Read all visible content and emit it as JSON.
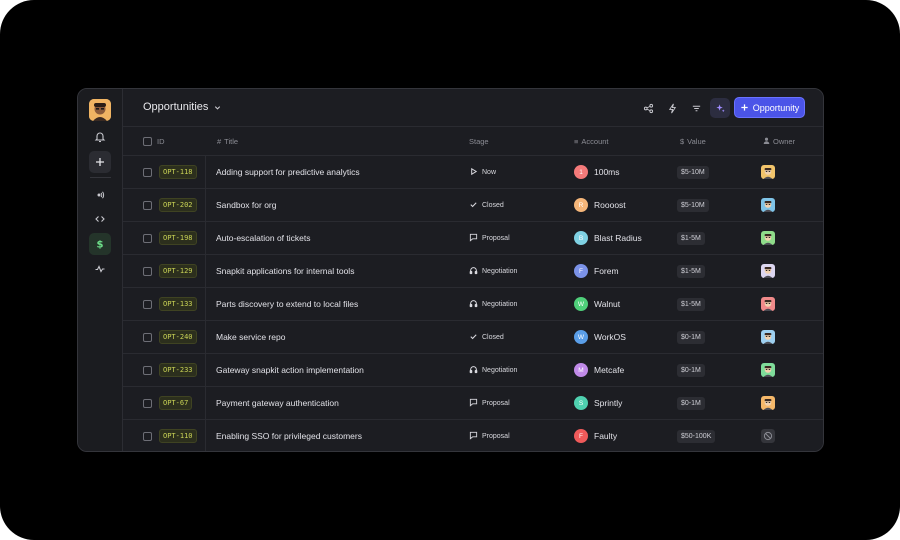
{
  "header": {
    "view_title": "Opportunities",
    "new_button_label": "Opportunity"
  },
  "columns": {
    "id": "ID",
    "title": "Title",
    "stage": "Stage",
    "account": "Account",
    "value": "Value",
    "owner": "Owner"
  },
  "rows": [
    {
      "id": "OPT-118",
      "title": "Adding support for predictive analytics",
      "stage": "Now",
      "stage_icon": "play-icon",
      "account": "100ms",
      "account_initial": "1",
      "account_color": "#f47a7a",
      "value": "$5-10M",
      "owner_color": "#f2c46b"
    },
    {
      "id": "OPT-202",
      "title": "Sandbox for org",
      "stage": "Closed",
      "stage_icon": "check-icon",
      "account": "Roooost",
      "account_initial": "R",
      "account_color": "#f5b67a",
      "value": "$5-10M",
      "owner_color": "#7fc4e8"
    },
    {
      "id": "OPT-198",
      "title": "Auto-escalation of tickets",
      "stage": "Proposal",
      "stage_icon": "message-icon",
      "account": "Blast Radius",
      "account_initial": "B",
      "account_color": "#7fd1e3",
      "value": "$1-5M",
      "owner_color": "#8fdc8a"
    },
    {
      "id": "OPT-129",
      "title": "Snapkit applications for internal tools",
      "stage": "Negotiation",
      "stage_icon": "headphones-icon",
      "account": "Forem",
      "account_initial": "F",
      "account_color": "#7b92e8",
      "value": "$1-5M",
      "owner_color": "#dcd6f0"
    },
    {
      "id": "OPT-133",
      "title": "Parts discovery to extend to local files",
      "stage": "Negotiation",
      "stage_icon": "headphones-icon",
      "account": "Walnut",
      "account_initial": "W",
      "account_color": "#4fcf7a",
      "value": "$1-5M",
      "owner_color": "#f08a8a"
    },
    {
      "id": "OPT-240",
      "title": "Make service repo",
      "stage": "Closed",
      "stage_icon": "check-icon",
      "account": "WorkOS",
      "account_initial": "W",
      "account_color": "#5a9ee8",
      "value": "$0-1M",
      "owner_color": "#9ed0f0"
    },
    {
      "id": "OPT-233",
      "title": "Gateway snapkit action implementation",
      "stage": "Negotiation",
      "stage_icon": "headphones-icon",
      "account": "Metcafe",
      "account_initial": "M",
      "account_color": "#c08ae8",
      "value": "$0-1M",
      "owner_color": "#7fdc9a"
    },
    {
      "id": "OPT-67",
      "title": "Payment gateway authentication",
      "stage": "Proposal",
      "stage_icon": "message-icon",
      "account": "Sprintly",
      "account_initial": "S",
      "account_color": "#4fd1b0",
      "value": "$0-1M",
      "owner_color": "#f5b86a"
    },
    {
      "id": "OPT-110",
      "title": "Enabling SSO for privileged customers",
      "stage": "Proposal",
      "stage_icon": "message-icon",
      "account": "Faulty",
      "account_initial": "F",
      "account_color": "#ef5a5a",
      "value": "$50-100K",
      "owner_color": "none"
    }
  ]
}
